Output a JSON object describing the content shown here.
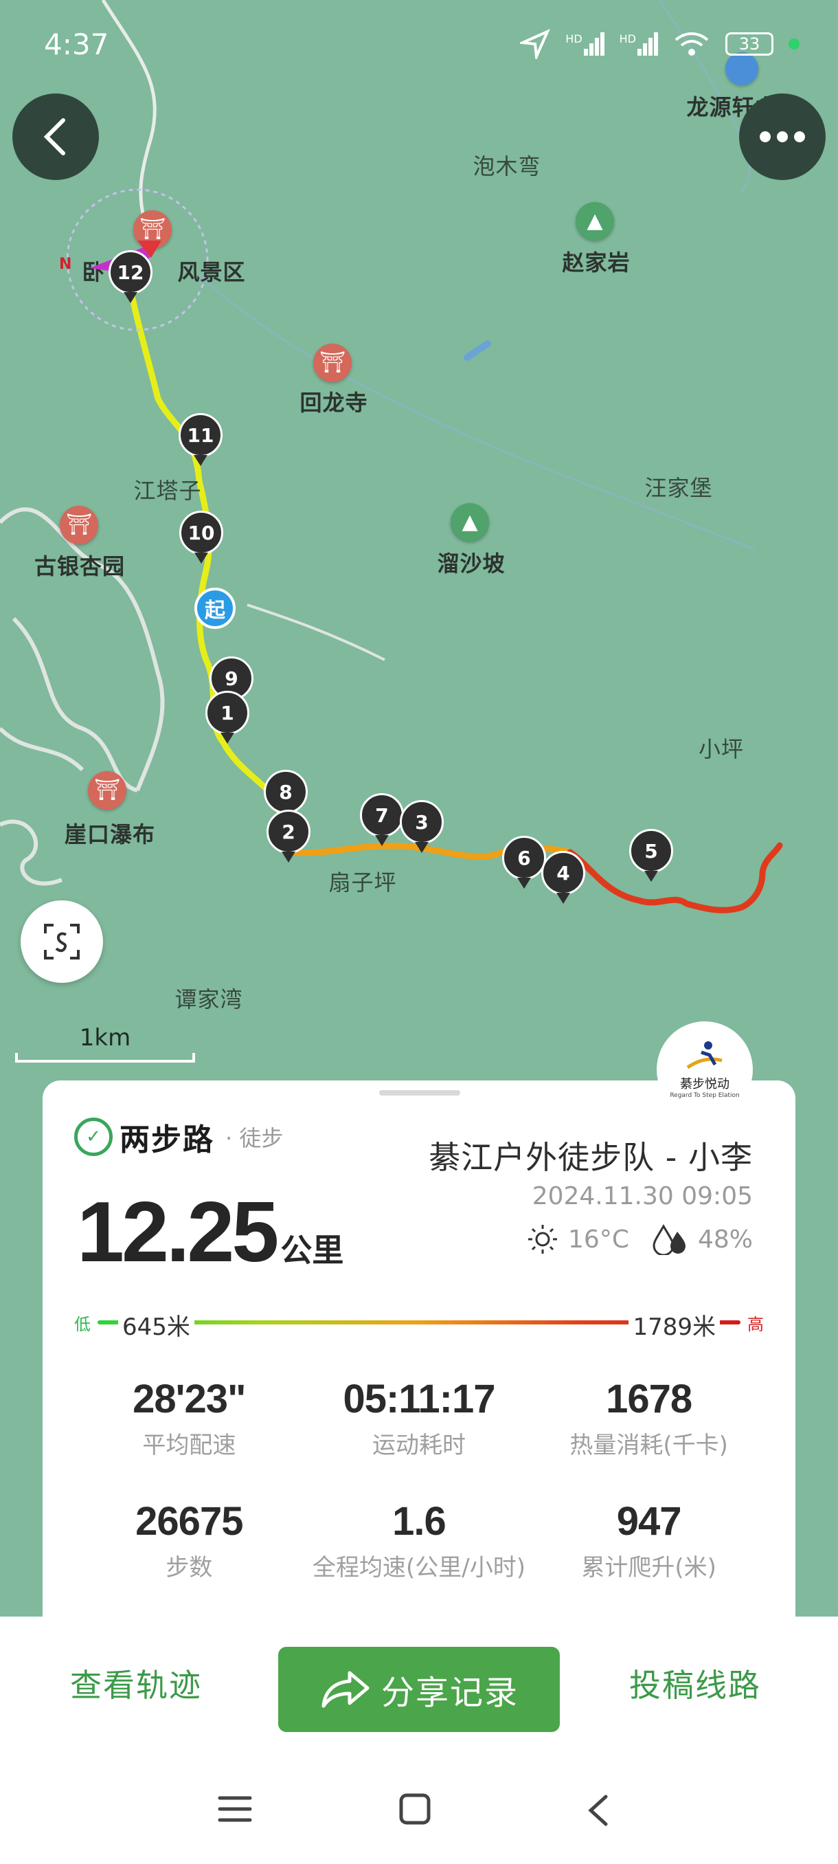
{
  "status_bar": {
    "time": "4:37",
    "battery": "33",
    "network_1": "HD",
    "network_2": "HD"
  },
  "map": {
    "places": [
      {
        "name": "泡木弯"
      },
      {
        "name": "赵家岩"
      },
      {
        "name": "回龙寺"
      },
      {
        "name": "江塔子"
      },
      {
        "name": "汪家堡"
      },
      {
        "name": "溜沙坡"
      },
      {
        "name": "古银杏园"
      },
      {
        "name": "小坪"
      },
      {
        "name": "崖口瀑布"
      },
      {
        "name": "扇子坪"
      },
      {
        "name": "谭家湾"
      },
      {
        "name": "龙源轩山庄"
      },
      {
        "name": "卧"
      },
      {
        "name": "风景区"
      }
    ],
    "markers": [
      "12",
      "11",
      "10",
      "9",
      "1",
      "8",
      "2",
      "7",
      "3",
      "6",
      "4",
      "5"
    ],
    "start_label": "起",
    "scale_label": "1km",
    "compass_label": "N"
  },
  "card": {
    "brand_name": "两步路",
    "activity_type": "· 徒步",
    "team_name": "綦江户外徒步队 - 小李",
    "datetime": "2024.11.30 09:05",
    "distance_value": "12.25",
    "distance_unit": "公里",
    "temperature": "16°C",
    "humidity": "48%",
    "elevation": {
      "low_tag": "低",
      "high_tag": "高",
      "min": "645米",
      "max": "1789米"
    },
    "stats": [
      {
        "value": "28'23\"",
        "label": "平均配速"
      },
      {
        "value": "05:11:17",
        "label": "运动耗时"
      },
      {
        "value": "1678",
        "label": "热量消耗(千卡)"
      },
      {
        "value": "26675",
        "label": "步数"
      },
      {
        "value": "1.6",
        "label": "全程均速(公里/小时)"
      },
      {
        "value": "947",
        "label": "累计爬升(米)"
      }
    ],
    "club_logo_text": "綦步悦动",
    "club_logo_sub": "Regard To Step Elation"
  },
  "actions": {
    "view_track": "查看轨迹",
    "share": "分享记录",
    "submit_route": "投稿线路"
  },
  "colors": {
    "map_bg": "#80b99c",
    "accent_green": "#4ba54a",
    "track_low": "#27d43c",
    "track_high": "#d11a1a"
  }
}
